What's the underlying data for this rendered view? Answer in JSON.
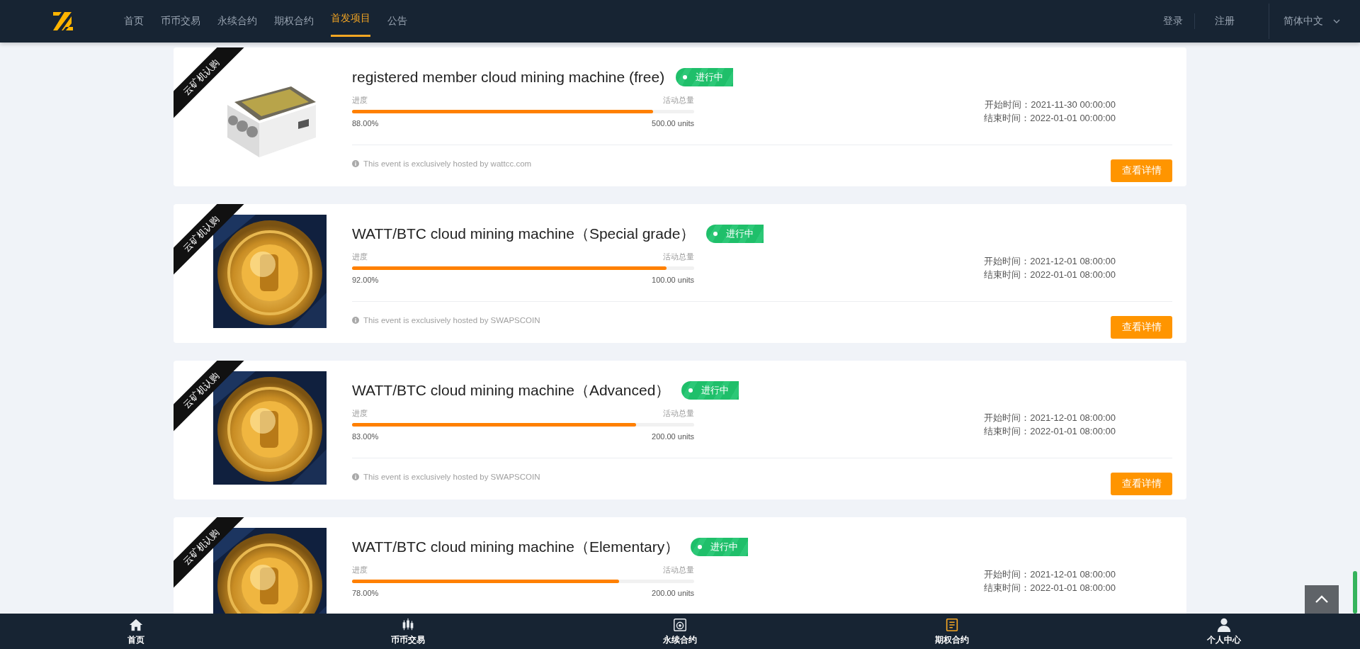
{
  "header": {
    "nav": [
      {
        "label": "首页",
        "selected": false
      },
      {
        "label": "币币交易",
        "selected": false
      },
      {
        "label": "永续合约",
        "selected": false
      },
      {
        "label": "期权合约",
        "selected": false
      },
      {
        "label": "首发项目",
        "selected": true
      },
      {
        "label": "公告",
        "selected": false
      }
    ],
    "login": "登录",
    "register": "注册",
    "language": "简体中文"
  },
  "projects": [
    {
      "kind": "machine",
      "ribbon": "云矿机认购",
      "title": "registered member cloud mining machine (free)",
      "status": "进行中",
      "progress_label": "进度",
      "total_label": "活动总量",
      "level": 0.88,
      "percent": "88.00%",
      "total": "500.00 units",
      "start": "开始时间：2021-11-30 00:00:00",
      "end": "结束时间：2022-01-01 00:00:00",
      "host": "This event is exclusively hosted by wattcc.com",
      "button": "查看详情"
    },
    {
      "kind": "coin",
      "ribbon": "云矿机认购",
      "title": "WATT/BTC cloud mining machine（Special grade）",
      "status": "进行中",
      "progress_label": "进度",
      "total_label": "活动总量",
      "level": 0.92,
      "percent": "92.00%",
      "total": "100.00 units",
      "start": "开始时间：2021-12-01 08:00:00",
      "end": "结束时间：2022-01-01 08:00:00",
      "host": "This event is exclusively hosted by SWAPSCOIN",
      "button": "查看详情"
    },
    {
      "kind": "coin",
      "ribbon": "云矿机认购",
      "title": "WATT/BTC cloud mining machine（Advanced）",
      "status": "进行中",
      "progress_label": "进度",
      "total_label": "活动总量",
      "level": 0.83,
      "percent": "83.00%",
      "total": "200.00 units",
      "start": "开始时间：2021-12-01 08:00:00",
      "end": "结束时间：2022-01-01 08:00:00",
      "host": "This event is exclusively hosted by SWAPSCOIN",
      "button": "查看详情"
    },
    {
      "kind": "coin",
      "ribbon": "云矿机认购",
      "title": "WATT/BTC cloud mining machine（Elementary）",
      "status": "进行中",
      "progress_label": "进度",
      "total_label": "活动总量",
      "level": 0.78,
      "percent": "78.00%",
      "total": "200.00 units",
      "start": "开始时间：2021-12-01 08:00:00",
      "end": "结束时间：2022-01-01 08:00:00"
    }
  ],
  "bottom_nav": [
    {
      "kind": "home",
      "label": "首页",
      "selected": false
    },
    {
      "kind": "chart",
      "label": "币币交易",
      "selected": false
    },
    {
      "kind": "contract",
      "label": "永续合约",
      "selected": false
    },
    {
      "kind": "options",
      "label": "期权合约",
      "selected": true
    },
    {
      "kind": "user",
      "label": "个人中心",
      "selected": false
    }
  ]
}
